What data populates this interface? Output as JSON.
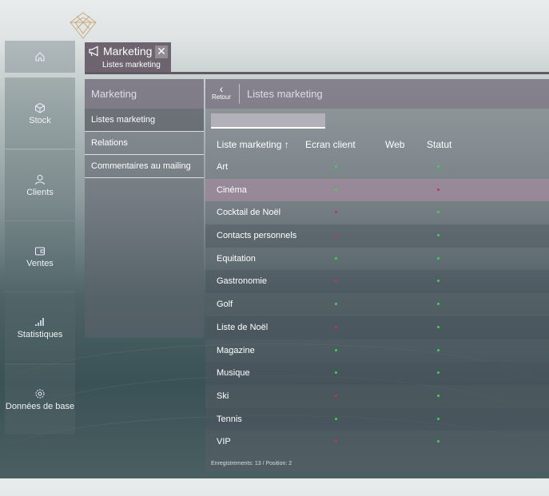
{
  "tab": {
    "title": "Marketing",
    "subtitle": "Listes marketing",
    "close": "✕"
  },
  "nav": [
    {
      "id": "stock",
      "label": "Stock",
      "icon": "box-icon"
    },
    {
      "id": "clients",
      "label": "Clients",
      "icon": "user-icon"
    },
    {
      "id": "ventes",
      "label": "Ventes",
      "icon": "wallet-icon"
    },
    {
      "id": "statistiques",
      "label": "Statistiques",
      "icon": "bar-chart-icon"
    },
    {
      "id": "donnees",
      "label": "Données de base",
      "icon": "gear-icon"
    }
  ],
  "submenu": {
    "title": "Marketing",
    "items": [
      "Listes marketing",
      "Relations",
      "Commentaires au mailing"
    ]
  },
  "main": {
    "back_label": "Retour",
    "title": "Listes marketing",
    "search_placeholder": "",
    "columns": [
      "Liste marketing ↑",
      "Ecran client",
      "Web",
      "Statut"
    ],
    "footer": "Enregistrements: 13 / Position: 2"
  },
  "colors": {
    "green": "#3ed64a",
    "red": "#d6285f"
  },
  "rows": [
    {
      "name": "Art",
      "ecran": "green",
      "statut": "green"
    },
    {
      "name": "Cinéma",
      "ecran": "green",
      "statut": "red"
    },
    {
      "name": "Cocktail de Noël",
      "ecran": "red",
      "statut": "green"
    },
    {
      "name": "Contacts personnels",
      "ecran": "red",
      "statut": "green"
    },
    {
      "name": "Equitation",
      "ecran": "green",
      "statut": "green"
    },
    {
      "name": "Gastronomie",
      "ecran": "red",
      "statut": "green"
    },
    {
      "name": "Golf",
      "ecran": "green",
      "statut": "green"
    },
    {
      "name": "Liste de Noël",
      "ecran": "red",
      "statut": "green"
    },
    {
      "name": "Magazine",
      "ecran": "green",
      "statut": "green"
    },
    {
      "name": "Musique",
      "ecran": "green",
      "statut": "green"
    },
    {
      "name": "Ski",
      "ecran": "red",
      "statut": "green"
    },
    {
      "name": "Tennis",
      "ecran": "green",
      "statut": "green"
    },
    {
      "name": "VIP",
      "ecran": "red",
      "statut": "green"
    }
  ]
}
